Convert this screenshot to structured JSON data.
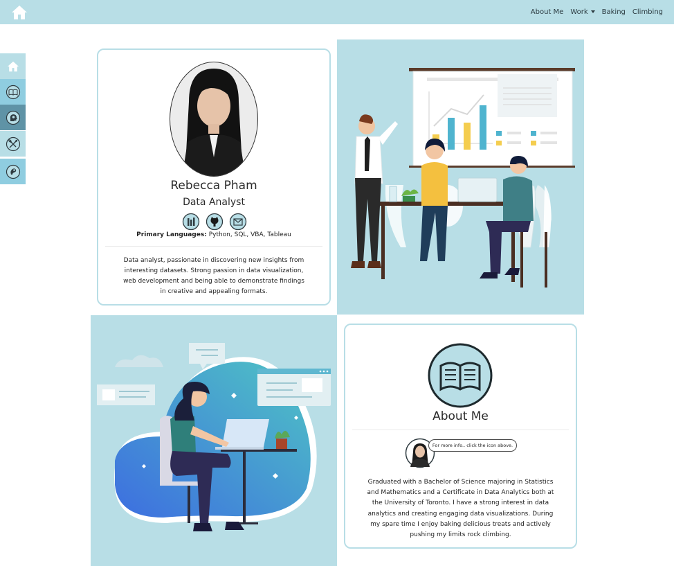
{
  "nav": {
    "links": [
      "About Me",
      "Work",
      "Baking",
      "Climbing"
    ]
  },
  "sidebar": {
    "icons": [
      "home-icon",
      "book-icon",
      "head-gears-icon",
      "whisk-spoon-icon",
      "climbing-hold-icon"
    ]
  },
  "profile": {
    "name": "Rebecca Pham",
    "title": "Data Analyst",
    "languages_label": "Primary Languages:",
    "languages": "Python, SQL, VBA, Tableau",
    "bio_lines": [
      "Data analyst, passionate in discovering new insights from",
      "interesting datasets. Strong passion in data visualization,",
      "web development and being able to demonstrate findings",
      "in creative and appealing formats."
    ]
  },
  "about": {
    "heading": "About Me",
    "bubble": "For more info.. click the icon above.",
    "lines": [
      "Graduated with a Bachelor of Science majoring in Statistics",
      "and Mathematics and a Certificate in Data Analytics both at",
      "the University of Toronto. I have a strong interest in data",
      "analytics and creating engaging data visualizations. During",
      "my spare time I enjoy baking delicious treats and actively",
      "pushing my limits rock climbing."
    ]
  },
  "colors": {
    "nav": "#b8dee6",
    "accent": "#5fb7d0",
    "card_border": "#b8dee6"
  }
}
